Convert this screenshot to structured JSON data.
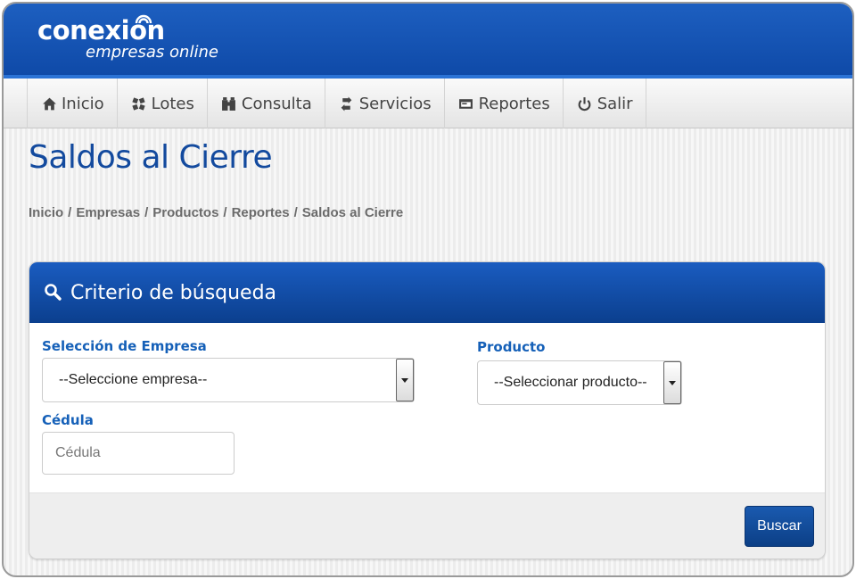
{
  "brand": {
    "name": "conexion",
    "tagline": "empresas online",
    "header_color": "#0f4aa8"
  },
  "nav": {
    "items": [
      {
        "label": "Inicio",
        "icon": "home-icon"
      },
      {
        "label": "Lotes",
        "icon": "lotes-icon"
      },
      {
        "label": "Consulta",
        "icon": "binoculars-icon"
      },
      {
        "label": "Servicios",
        "icon": "transfer-icon"
      },
      {
        "label": "Reportes",
        "icon": "report-icon"
      },
      {
        "label": "Salir",
        "icon": "power-icon"
      }
    ]
  },
  "page": {
    "title": "Saldos al Cierre",
    "breadcrumb": [
      "Inicio",
      "Empresas",
      "Productos",
      "Reportes",
      "Saldos al Cierre"
    ]
  },
  "panel": {
    "title": "Criterio de búsqueda",
    "icon": "search-icon",
    "empresa_label": "Selección de Empresa",
    "empresa_value": "--Seleccione empresa--",
    "producto_label": "Producto",
    "producto_value": "--Seleccionar producto--",
    "cedula_label": "Cédula",
    "cedula_placeholder": "Cédula",
    "search_button": "Buscar"
  },
  "colors": {
    "accent": "#134a9e",
    "label": "#1560b8",
    "button": "#0c3f86"
  }
}
